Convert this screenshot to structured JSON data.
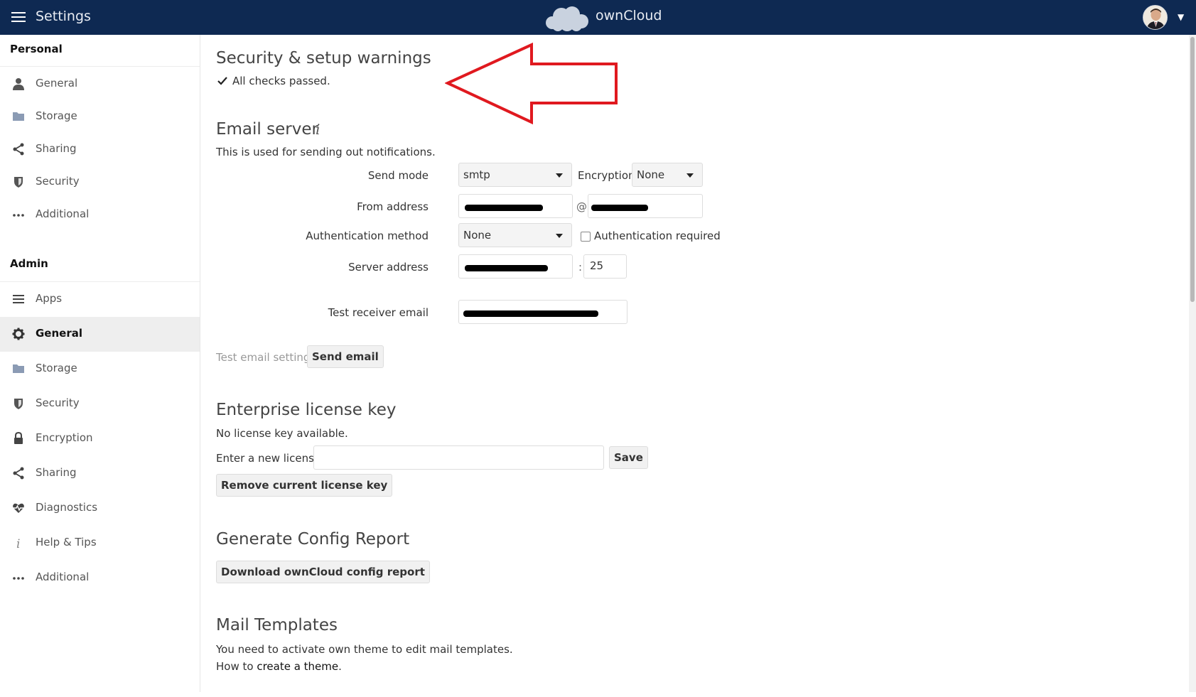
{
  "header": {
    "title": "Settings",
    "brand": "ownCloud",
    "menu_icon": "hamburger-icon",
    "avatar": "user-avatar",
    "background_color": "#0e2952"
  },
  "sidebar": {
    "personal_heading": "Personal",
    "personal_items": [
      {
        "label": "General",
        "icon": "user-icon"
      },
      {
        "label": "Storage",
        "icon": "folder-icon"
      },
      {
        "label": "Sharing",
        "icon": "share-icon"
      },
      {
        "label": "Security",
        "icon": "shield-icon"
      },
      {
        "label": "Additional",
        "icon": "ellipsis-icon"
      }
    ],
    "admin_heading": "Admin",
    "admin_items": [
      {
        "label": "Apps",
        "icon": "list-icon"
      },
      {
        "label": "General",
        "icon": "gear-icon",
        "active": true
      },
      {
        "label": "Storage",
        "icon": "folder-icon"
      },
      {
        "label": "Security",
        "icon": "shield-icon"
      },
      {
        "label": "Encryption",
        "icon": "lock-icon"
      },
      {
        "label": "Sharing",
        "icon": "share-icon"
      },
      {
        "label": "Diagnostics",
        "icon": "heartbeat-icon"
      },
      {
        "label": "Help & Tips",
        "icon": "info-icon"
      },
      {
        "label": "Additional",
        "icon": "ellipsis-icon"
      }
    ]
  },
  "security": {
    "title": "Security & setup warnings",
    "status": "All checks passed."
  },
  "email": {
    "title": "Email server",
    "description": "This is used for sending out notifications.",
    "send_mode_label": "Send mode",
    "send_mode_value": "smtp",
    "encryption_label": "Encryption",
    "encryption_value": "None",
    "from_label": "From address",
    "at_sign": "@",
    "auth_method_label": "Authentication method",
    "auth_method_value": "None",
    "auth_required_label": "Authentication required",
    "server_label": "Server address",
    "port_separator": ":",
    "port_value": "25",
    "test_receiver_label": "Test receiver email",
    "test_settings_label": "Test email settings",
    "send_email_button": "Send email"
  },
  "license": {
    "title": "Enterprise license key",
    "status": "No license key available.",
    "enter_label": "Enter a new license:",
    "save_button": "Save",
    "remove_button": "Remove current license key"
  },
  "config_report": {
    "title": "Generate Config Report",
    "download_button": "Download ownCloud config report"
  },
  "mail_templates": {
    "title": "Mail Templates",
    "text1": "You need to activate own theme to edit mail templates.",
    "text2_prefix": "How to ",
    "text2_link": "create a theme",
    "text2_suffix": "."
  },
  "annotation": {
    "arrow_color": "#e0191f"
  }
}
